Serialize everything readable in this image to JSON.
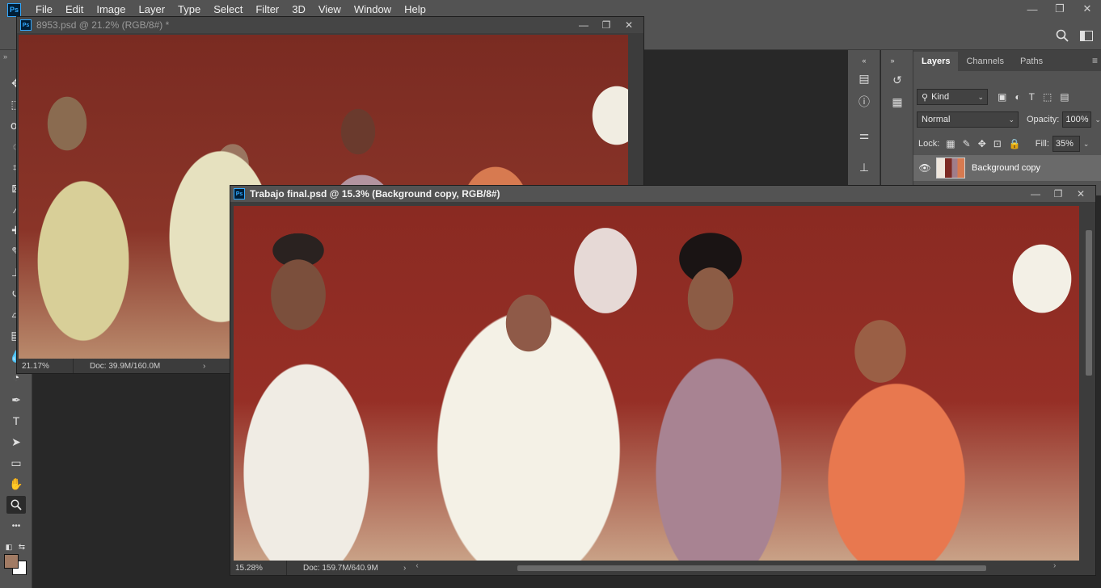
{
  "app": {
    "logo": "Ps",
    "menu": [
      "File",
      "Edit",
      "Image",
      "Layer",
      "Type",
      "Select",
      "Filter",
      "3D",
      "View",
      "Window",
      "Help"
    ]
  },
  "window_controls": {
    "minimize": "—",
    "restore": "❐",
    "close": "✕"
  },
  "tools": [
    "move-tool-icon",
    "marquee-tool-icon",
    "lasso-tool-icon",
    "quick-select-tool-icon",
    "crop-tool-icon",
    "frame-tool-icon",
    "eyedropper-tool-icon",
    "healing-brush-tool-icon",
    "brush-tool-icon",
    "clone-stamp-tool-icon",
    "history-brush-tool-icon",
    "eraser-tool-icon",
    "gradient-tool-icon",
    "blur-tool-icon",
    "dodge-tool-icon",
    "pen-tool-icon",
    "type-tool-icon",
    "path-selection-tool-icon",
    "rectangle-tool-icon",
    "hand-tool-icon",
    "zoom-tool-icon",
    "more-tools-icon"
  ],
  "tool_glyphs": {
    "type": "T",
    "more": "•••"
  },
  "colors": {
    "foreground": "#a17b64",
    "background": "#ffffff",
    "ps_blue": "#31a8ff"
  },
  "doc1": {
    "title": "8953.psd @ 21.2% (RGB/8#) *",
    "zoom": "21.17%",
    "doc_size": "Doc: 39.9M/160.0M"
  },
  "doc2": {
    "title": "Trabajo final.psd @ 15.3% (Background copy, RGB/8#)",
    "zoom": "15.28%",
    "doc_size": "Doc: 159.7M/640.9M"
  },
  "layers_panel": {
    "tabs": [
      "Layers",
      "Channels",
      "Paths"
    ],
    "filter_kind": "Kind",
    "blend_mode": "Normal",
    "opacity_label": "Opacity:",
    "opacity_value": "100%",
    "lock_label": "Lock:",
    "fill_label": "Fill:",
    "fill_value": "35%",
    "layers": [
      {
        "name": "Background copy",
        "visible": true
      }
    ]
  }
}
